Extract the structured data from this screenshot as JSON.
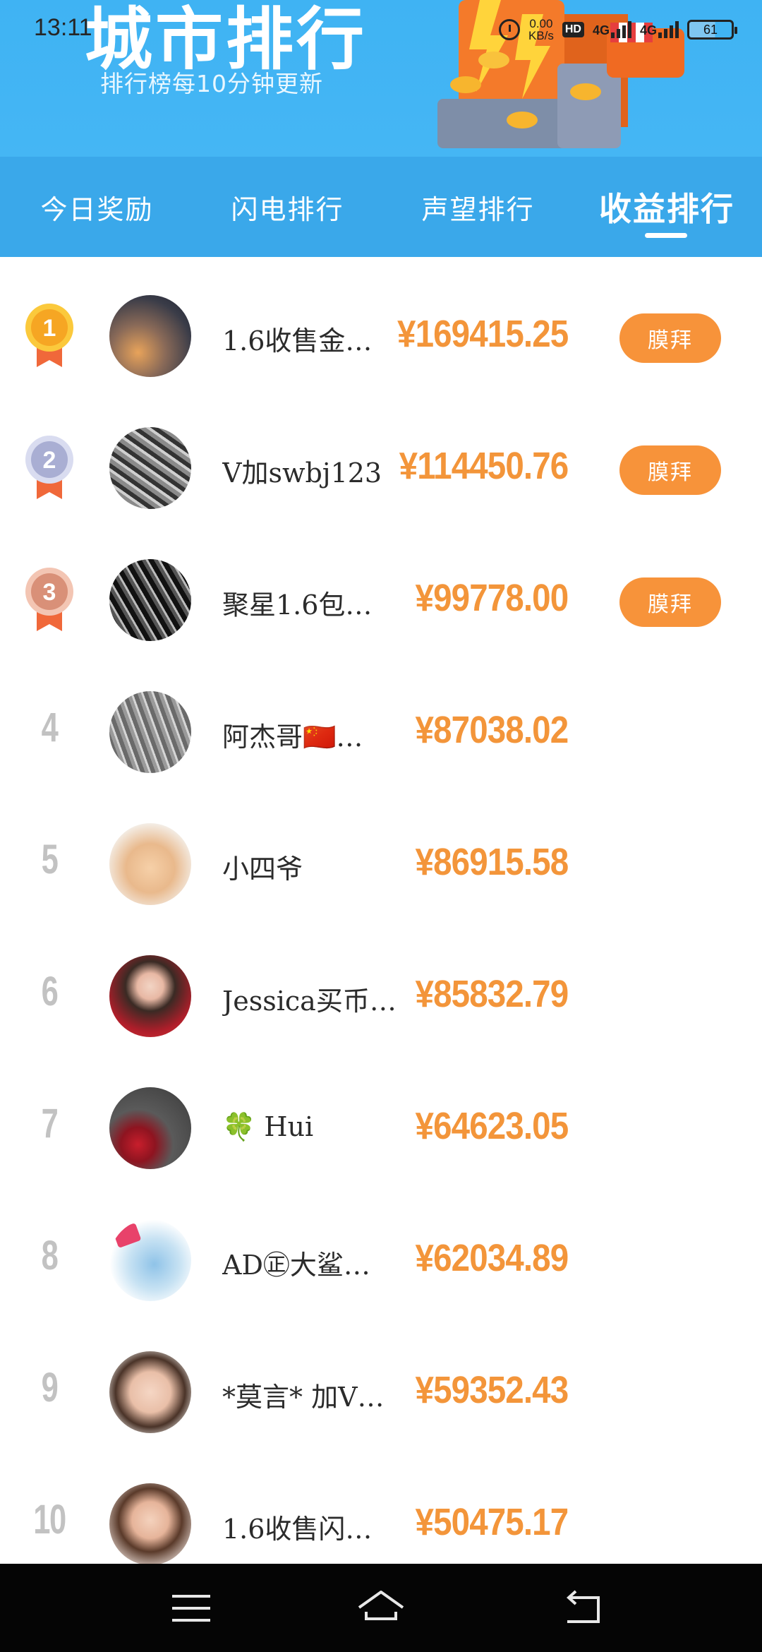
{
  "status_bar": {
    "time": "13:11",
    "speed_value": "0.00",
    "speed_unit": "KB/s",
    "hd_label": "HD",
    "net1": "4G",
    "net2": "4G",
    "battery": "61"
  },
  "header": {
    "title": "城市排行",
    "subtitle": "排行榜每10分钟更新"
  },
  "tabs": [
    {
      "label": "今日奖励",
      "active": false
    },
    {
      "label": "闪电排行",
      "active": false
    },
    {
      "label": "声望排行",
      "active": false
    },
    {
      "label": "收益排行",
      "active": true
    }
  ],
  "worship_label": "膜拜",
  "rankings": [
    {
      "rank": "1",
      "name": "1.6收售金…",
      "amount": "¥169415.25",
      "medal": "gold"
    },
    {
      "rank": "2",
      "name": "V加swbj123",
      "amount": "¥114450.76",
      "medal": "silver"
    },
    {
      "rank": "3",
      "name": "聚星1.6包…",
      "amount": "¥99778.00",
      "medal": "bronze"
    },
    {
      "rank": "4",
      "name": "阿杰哥🇨🇳…",
      "amount": "¥87038.02"
    },
    {
      "rank": "5",
      "name": "小四爷",
      "amount": "¥86915.58"
    },
    {
      "rank": "6",
      "name": "Jessica买币…",
      "amount": "¥85832.79"
    },
    {
      "rank": "7",
      "name": "🍀 Hui",
      "amount": "¥64623.05"
    },
    {
      "rank": "8",
      "name": "AD㊣大鲨…",
      "amount": "¥62034.89"
    },
    {
      "rank": "9",
      "name": "*莫言* 加V…",
      "amount": "¥59352.43"
    },
    {
      "rank": "10",
      "name": "1.6收售闪…",
      "amount": "¥50475.17"
    }
  ],
  "colors": {
    "header_bg": "#3fb3f3",
    "tab_bg": "#3aa8ea",
    "amount": "#f3953a",
    "button": "#f7933a",
    "rank_gray": "#c2c2c2"
  }
}
